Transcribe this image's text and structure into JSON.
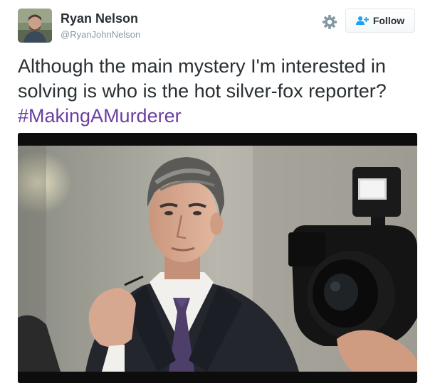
{
  "tweet": {
    "author": {
      "name": "Ryan Nelson",
      "handle": "@RyanJohnNelson",
      "avatar_icon": "user-avatar"
    },
    "actions": {
      "settings_icon": "gear-icon",
      "follow_icon": "add-user-icon",
      "follow_label": "Follow"
    },
    "text": "Although the main mystery I'm interested in solving is who is the hot silver-fox reporter?",
    "hashtag": "#MakingAMurderer",
    "media": {
      "kind": "photo",
      "subject": "reporter-photo"
    }
  },
  "colors": {
    "text": "#292f33",
    "muted": "#8899a6",
    "hashtag": "#6b3fa0",
    "border": "#e1e8ed",
    "follow_icon": "#1da1f2"
  }
}
